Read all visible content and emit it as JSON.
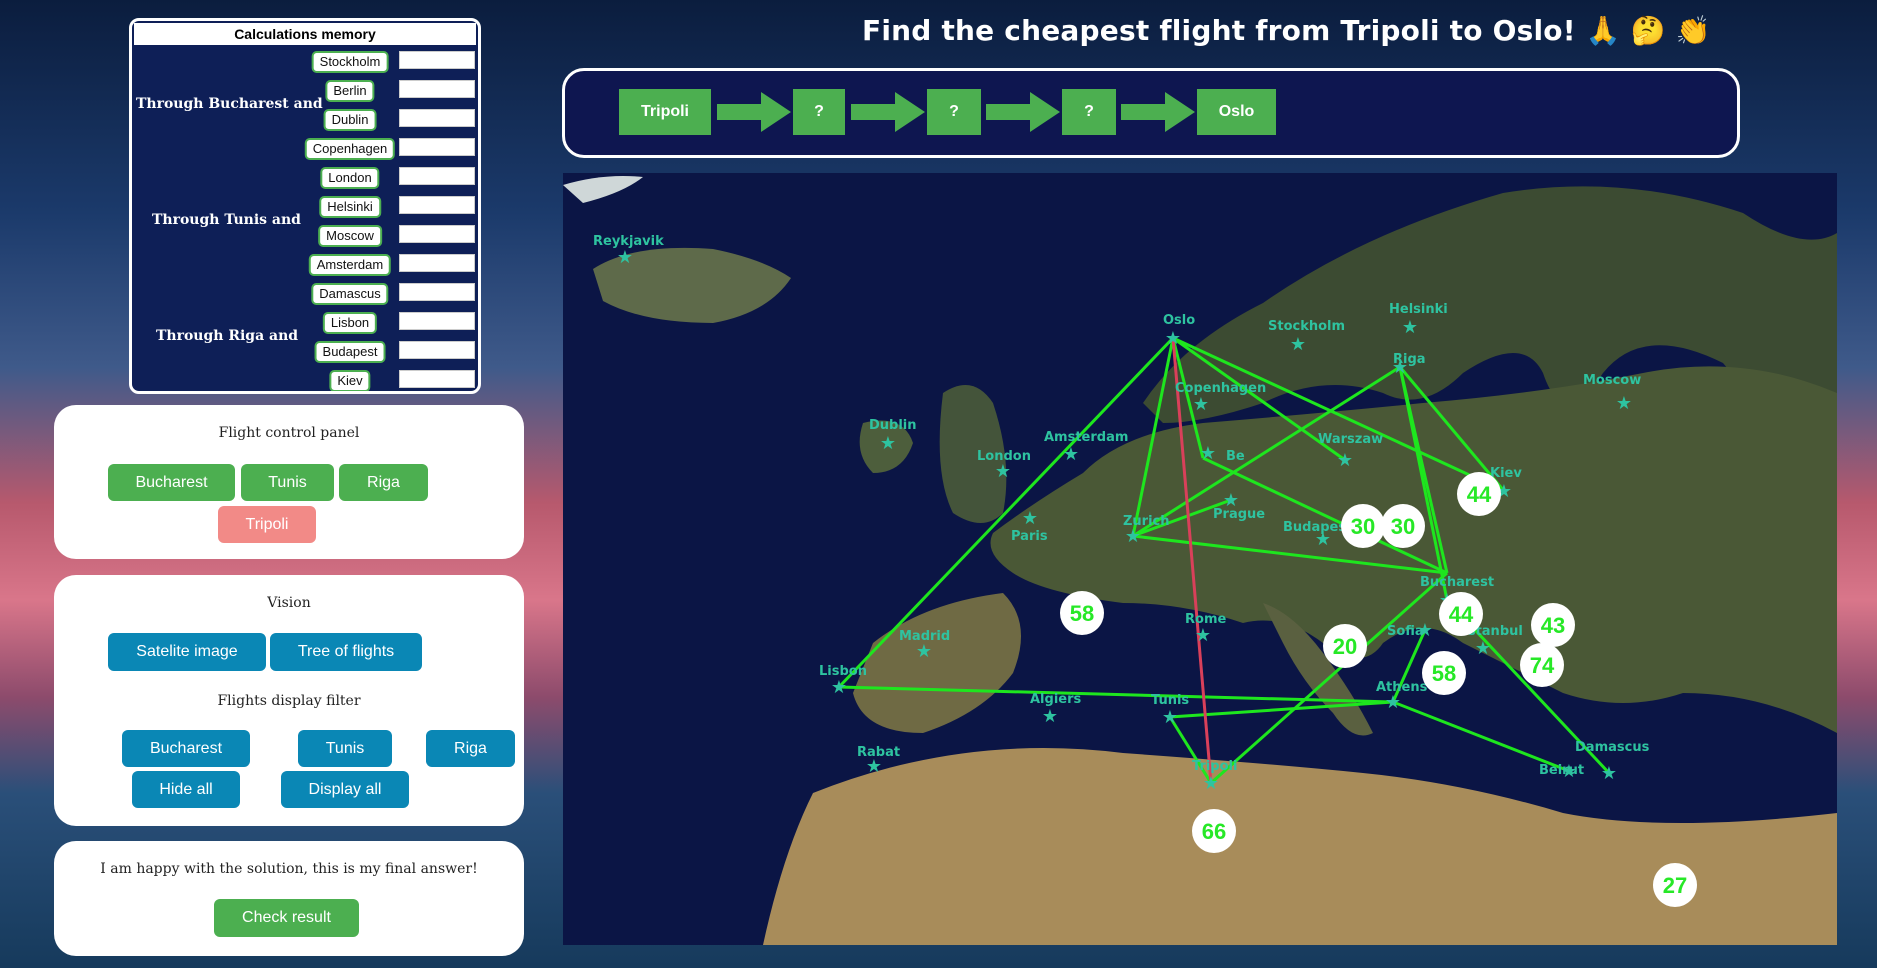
{
  "title": "Find the cheapest flight from Tripoli to Oslo! 🙏 🤔 👏",
  "memory": {
    "header": "Calculations memory",
    "groups": [
      {
        "label": "Through Bucharest and",
        "cities": [
          "Stockholm",
          "Berlin",
          "Dublin",
          "Copenhagen"
        ]
      },
      {
        "label": "Through Tunis and",
        "cities": [
          "London",
          "Helsinki",
          "Moscow",
          "Amsterdam"
        ]
      },
      {
        "label": "Through Riga and",
        "cities": [
          "Damascus",
          "Lisbon",
          "Budapest",
          "Kiev"
        ]
      }
    ]
  },
  "route": {
    "steps": [
      "Tripoli",
      "?",
      "?",
      "?",
      "Oslo"
    ],
    "arrow_color": "#4caf50"
  },
  "flight_panel": {
    "title": "Flight control panel",
    "buttons": [
      "Bucharest",
      "Tunis",
      "Riga"
    ],
    "current": "Tripoli"
  },
  "vision": {
    "title": "Vision",
    "buttons": [
      "Satelite image",
      "Tree of flights"
    ],
    "filter_title": "Flights display filter",
    "filter_buttons": [
      "Bucharest",
      "Tunis",
      "Riga",
      "Hide all",
      "Display all"
    ]
  },
  "final": {
    "text": "I am happy with the solution, this is my final answer!",
    "button": "Check result"
  },
  "map": {
    "cities": [
      "Reykjavik",
      "Oslo",
      "Stockholm",
      "Helsinki",
      "Riga",
      "Moscow",
      "Copenhagen",
      "Dublin",
      "Amsterdam",
      "London",
      "Warszaw",
      "Be",
      "Kiev",
      "Prague",
      "Zurich",
      "Budapest",
      "Paris",
      "Bucharest",
      "Madrid",
      "Rome",
      "Sofia",
      "Istanbul",
      "Lisbon",
      "Algiers",
      "Tunis",
      "Athens",
      "Rabat",
      "Tripoli",
      "Damascus",
      "Beirut"
    ],
    "prices": [
      "58",
      "30",
      "30",
      "44",
      "44",
      "43",
      "20",
      "74",
      "58",
      "66",
      "27"
    ],
    "colors": {
      "route": "#1ee61e",
      "direct": "#d9405a",
      "star": "#2ec3a0"
    }
  }
}
